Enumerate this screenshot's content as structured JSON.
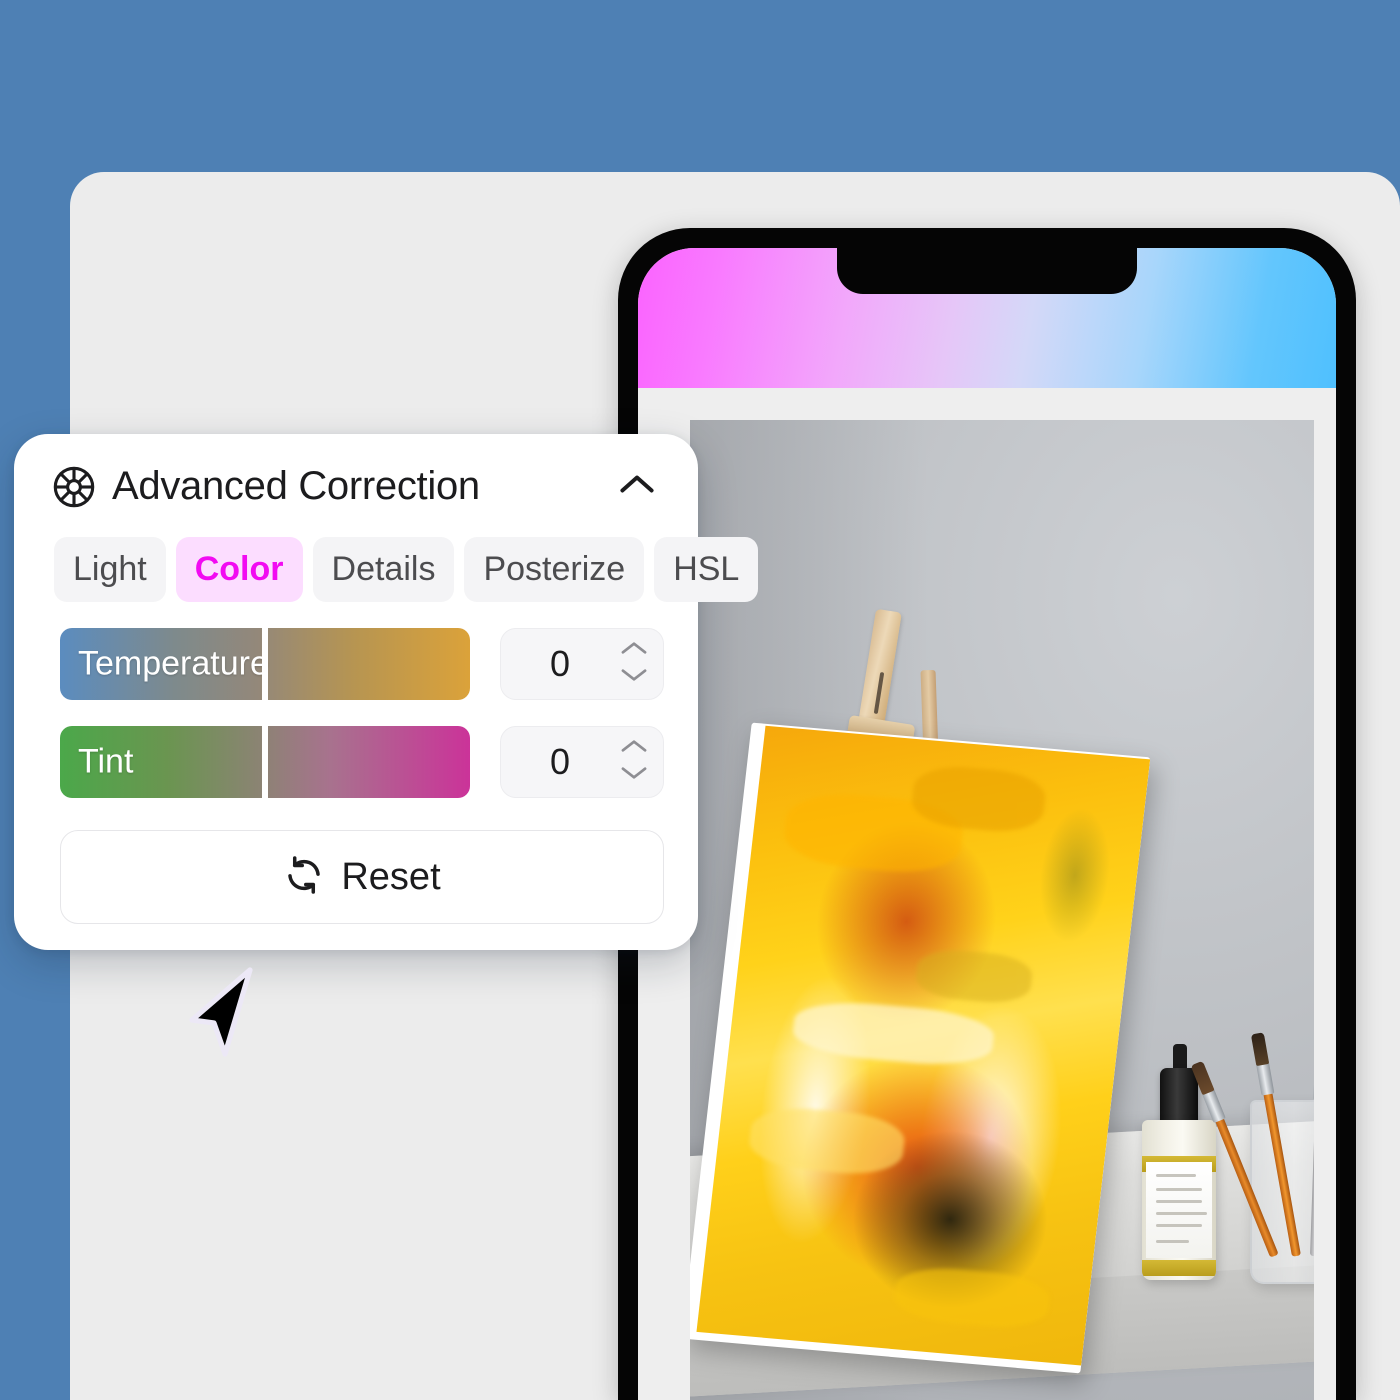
{
  "theme": {
    "background_color": "#4e80b4",
    "surface_color": "#ececec",
    "panel_color": "#ffffff",
    "accent_color": "#f20af2",
    "accent_bg_color": "#fcddff",
    "text_color": "#1c1c1e"
  },
  "panel": {
    "title": "Advanced Correction",
    "header_icon": "color-wheel-icon",
    "collapse_icon": "chevron-up-icon",
    "tabs": [
      {
        "label": "Light",
        "active": false
      },
      {
        "label": "Color",
        "active": true
      },
      {
        "label": "Details",
        "active": false
      },
      {
        "label": "Posterize",
        "active": false
      },
      {
        "label": "HSL",
        "active": false
      }
    ],
    "sliders": [
      {
        "label": "Temperature",
        "value": "0",
        "thumb_percent": 50,
        "gradient_from": "#5b8cbf",
        "gradient_to": "#dba23a",
        "stepper_up_icon": "chevron-up-icon",
        "stepper_down_icon": "chevron-down-icon"
      },
      {
        "label": "Tint",
        "value": "0",
        "thumb_percent": 50,
        "gradient_from": "#4ba84a",
        "gradient_to": "#cb3399",
        "stepper_up_icon": "chevron-up-icon",
        "stepper_down_icon": "chevron-down-icon"
      }
    ],
    "reset": {
      "label": "Reset",
      "icon": "refresh-icon"
    }
  },
  "phone": {
    "status_gradient_from": "#fa63ff",
    "status_gradient_to": "#4fc0fe",
    "bezel_color": "#050505",
    "screen_color": "#eeeeee",
    "photo_alt": "Yellow abstract painting on a canvas resting on a wooden easel, with a dropper bottle and a glass jar of paintbrushes on a white shelf"
  },
  "cursor": {
    "icon": "arrow-pointer-icon"
  }
}
